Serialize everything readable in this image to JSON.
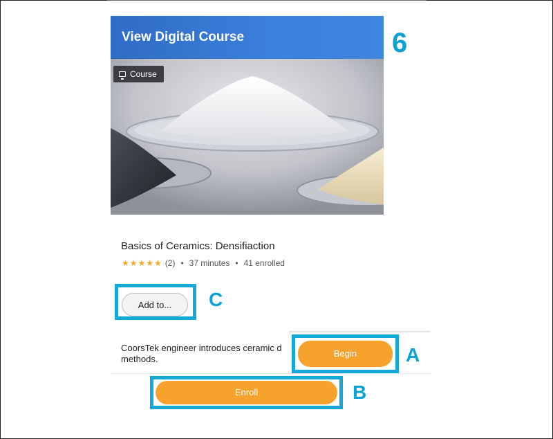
{
  "header": {
    "title": "View Digital Course"
  },
  "annotations": {
    "step_number": "6",
    "label_a": "A",
    "label_b": "B",
    "label_c": "C"
  },
  "hero": {
    "badge_label": "Course",
    "badge_icon": "presentation-icon"
  },
  "course": {
    "title": "Basics of Ceramics: Densifiaction",
    "stars": "★★★★★",
    "rating_count": "(2)",
    "separator": "•",
    "duration": "37 minutes",
    "enrolled": "41 enrolled",
    "description": "CoorsTek engineer introduces ceramic d methods."
  },
  "buttons": {
    "add_to": "Add to...",
    "begin": "Begin",
    "enroll": "Enroll"
  },
  "colors": {
    "header_blue": "#3b80db",
    "callout_blue": "#14a9d9",
    "button_orange": "#f7a22d",
    "star": "#f5a623"
  }
}
